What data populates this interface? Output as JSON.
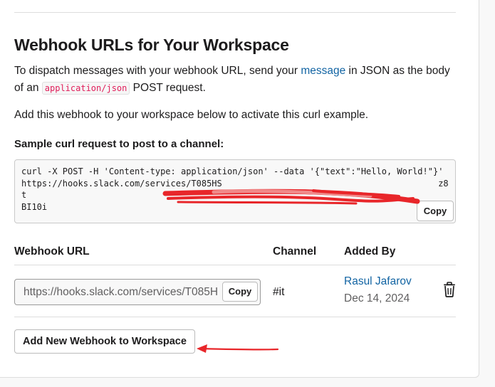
{
  "section": {
    "title": "Webhook URLs for Your Workspace",
    "desc_part1": "To dispatch messages with your webhook URL, send your ",
    "desc_link": "message",
    "desc_part2": " in JSON as the body of an ",
    "desc_code": "application/json",
    "desc_part3": " POST request.",
    "activate_text": "Add this webhook to your workspace below to activate this curl example."
  },
  "sample": {
    "label": "Sample curl request to post to a channel:",
    "code": "curl -X POST -H 'Content-type: application/json' --data '{\"text\":\"Hello, World!\"}'\nhttps://hooks.slack.com/services/T085HS                                          z8t\nBI10i",
    "copy_label": "Copy"
  },
  "table": {
    "headers": {
      "url": "Webhook URL",
      "channel": "Channel",
      "added_by": "Added By"
    },
    "rows": [
      {
        "url": "https://hooks.slack.com/services/T085H",
        "copy_label": "Copy",
        "channel": "#it",
        "added_by_name": "Rasul Jafarov",
        "added_by_date": "Dec 14, 2024",
        "delete_icon": "trash-icon"
      }
    ]
  },
  "add_button_label": "Add New Webhook to Workspace",
  "colors": {
    "link": "#1264a3",
    "code_text": "#e01e5a",
    "annotation": "#e8262a"
  }
}
